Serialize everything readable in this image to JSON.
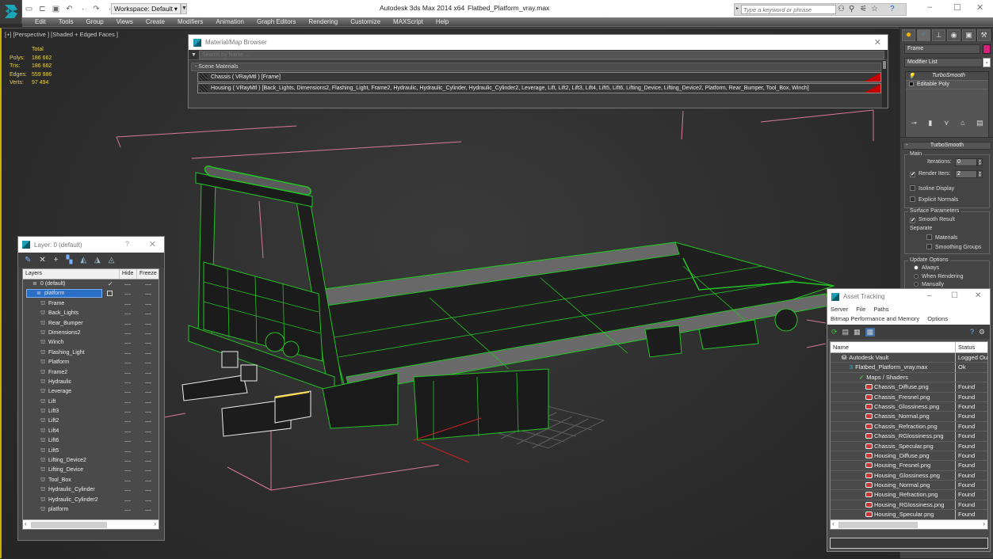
{
  "window": {
    "app_title": "Autodesk 3ds Max  2014 x64",
    "file_title": "Flatbed_Platform_vray.max",
    "workspace_label": "Workspace: Default",
    "help_search_placeholder": "Type a keyword or phrase",
    "quick_access": [
      "new-icon",
      "open-icon",
      "save-icon",
      "undo-icon",
      "redo-icon",
      "project-folder-icon"
    ],
    "help_icons": [
      "binoculars-icon",
      "key-icon",
      "satellite-icon",
      "star-icon",
      "help-icon"
    ]
  },
  "menu": [
    "Edit",
    "Tools",
    "Group",
    "Views",
    "Create",
    "Modifiers",
    "Animation",
    "Graph Editors",
    "Rendering",
    "Customize",
    "MAXScript",
    "Help"
  ],
  "viewport": {
    "label": "[+] [Perspective ] [Shaded + Edged Faces ]",
    "stats_header": "Total",
    "stats": [
      {
        "key": "Polys:",
        "value": "186 662"
      },
      {
        "key": "Tris:",
        "value": "186 662"
      },
      {
        "key": "Edges:",
        "value": "559 986"
      },
      {
        "key": "Verts:",
        "value": "97 494"
      }
    ],
    "selection_color": "#22c422",
    "highlight_color": "#c8b400"
  },
  "material_browser": {
    "title": "Material/Map Browser",
    "search_placeholder": "Search by Name ...",
    "section": "- Scene Materials",
    "items": [
      {
        "label": "Chassis  ( VRayMtl ) [Frame]"
      },
      {
        "label": "Housing  ( VRayMtl ) [Back_Lights, Dimensions2, Flashing_Light, Frame2, Hydraulic, Hydraulic_Cylinder, Hydraulic_Cylinder2, Leverage, Lift, Lift2, Lift3, Lift4, Lift5, Lift6, Lifting_Device, Lifting_Device2, Platform, Rear_Bumper, Tool_Box, Winch]"
      }
    ]
  },
  "command_panel": {
    "tabs": [
      "create-icon",
      "modify-icon",
      "hierarchy-icon",
      "motion-icon",
      "display-icon",
      "utilities-icon"
    ],
    "object_name": "Frame",
    "object_color": "#d8217a",
    "modifier_list": "Modifier List",
    "stack": [
      {
        "label": "TurboSmooth",
        "selected": true
      },
      {
        "label": "Editable Poly",
        "selected": false
      }
    ],
    "rollout_title": "TurboSmooth",
    "main_group": "Main",
    "iterations_label": "Iterations:",
    "iterations_value": "0",
    "render_iters_label": "Render Iters:",
    "render_iters_value": "2",
    "render_iters_checked": true,
    "isoline_label": "Isoline Display",
    "explicit_normals_label": "Explicit Normals",
    "surface_group": "Surface Parameters",
    "smooth_result_label": "Smooth Result",
    "separate_label": "Separate",
    "materials_label": "Materials",
    "smoothing_groups_label": "Smoothing Groups",
    "update_group": "Update Options",
    "update_options": [
      {
        "label": "Always",
        "selected": true
      },
      {
        "label": "When Rendering",
        "selected": false
      },
      {
        "label": "Manually",
        "selected": false
      }
    ]
  },
  "layer_dialog": {
    "title": "Layer: 0 (default)",
    "help": "?",
    "columns": [
      "Layers",
      "Hide",
      "Freeze"
    ],
    "toolbar": [
      "create-layer-icon",
      "delete-layer-icon",
      "add-to-layer-icon",
      "select-objects-icon",
      "highlight-icon",
      "hide-all-icon",
      "freeze-all-icon"
    ],
    "rows": [
      {
        "name": "0 (default)",
        "level": 0,
        "type": "layer",
        "active": true
      },
      {
        "name": "platform",
        "level": 0,
        "type": "layer",
        "selected": true
      },
      {
        "name": "Frame",
        "level": 1,
        "type": "object"
      },
      {
        "name": "Back_Lights",
        "level": 1,
        "type": "object"
      },
      {
        "name": "Rear_Bumper",
        "level": 1,
        "type": "object"
      },
      {
        "name": "Dimensions2",
        "level": 1,
        "type": "object"
      },
      {
        "name": "Winch",
        "level": 1,
        "type": "object"
      },
      {
        "name": "Flashing_Light",
        "level": 1,
        "type": "object"
      },
      {
        "name": "Platform",
        "level": 1,
        "type": "object"
      },
      {
        "name": "Frame2",
        "level": 1,
        "type": "object"
      },
      {
        "name": "Hydraulic",
        "level": 1,
        "type": "object"
      },
      {
        "name": "Leverage",
        "level": 1,
        "type": "object"
      },
      {
        "name": "Lift",
        "level": 1,
        "type": "object"
      },
      {
        "name": "Lift3",
        "level": 1,
        "type": "object"
      },
      {
        "name": "Lift2",
        "level": 1,
        "type": "object"
      },
      {
        "name": "Lift4",
        "level": 1,
        "type": "object"
      },
      {
        "name": "Lift6",
        "level": 1,
        "type": "object"
      },
      {
        "name": "Lift5",
        "level": 1,
        "type": "object"
      },
      {
        "name": "Lifting_Device2",
        "level": 1,
        "type": "object"
      },
      {
        "name": "Lifting_Device",
        "level": 1,
        "type": "object"
      },
      {
        "name": "Tool_Box",
        "level": 1,
        "type": "object"
      },
      {
        "name": "Hydraulic_Cylinder",
        "level": 1,
        "type": "object"
      },
      {
        "name": "Hydraulic_Cylinder2",
        "level": 1,
        "type": "object"
      },
      {
        "name": "platform",
        "level": 1,
        "type": "object"
      }
    ]
  },
  "asset_tracking": {
    "title": "Asset Tracking",
    "menu_row1": [
      "Server",
      "File",
      "Paths"
    ],
    "menu_row2": [
      "Bitmap Performance and Memory",
      "Options"
    ],
    "toolbar": [
      "refresh-icon",
      "list-icon",
      "details-icon",
      "table-icon",
      "help-vault-icon",
      "settings-vault-icon"
    ],
    "columns": [
      "Name",
      "Status"
    ],
    "rows": [
      {
        "name": "Autodesk Vault",
        "status": "Logged Ou",
        "level": 0,
        "icon": "vault-icon"
      },
      {
        "name": "Flatbed_Platform_vray.max",
        "status": "Ok",
        "level": 1,
        "icon": "max-file-icon"
      },
      {
        "name": "Maps / Shaders",
        "status": "",
        "level": 2,
        "icon": "maps-icon"
      },
      {
        "name": "Chassis_Diffuse.png",
        "status": "Found",
        "level": 3,
        "icon": "png-icon"
      },
      {
        "name": "Chassis_Fresnel.png",
        "status": "Found",
        "level": 3,
        "icon": "png-icon"
      },
      {
        "name": "Chassis_Glossiness.png",
        "status": "Found",
        "level": 3,
        "icon": "png-icon"
      },
      {
        "name": "Chassis_Normal.png",
        "status": "Found",
        "level": 3,
        "icon": "png-icon"
      },
      {
        "name": "Chassis_Refraction.png",
        "status": "Found",
        "level": 3,
        "icon": "png-icon"
      },
      {
        "name": "Chassis_RGlossiness.png",
        "status": "Found",
        "level": 3,
        "icon": "png-icon"
      },
      {
        "name": "Chassis_Specular.png",
        "status": "Found",
        "level": 3,
        "icon": "png-icon"
      },
      {
        "name": "Housing_Diffuse.png",
        "status": "Found",
        "level": 3,
        "icon": "png-icon"
      },
      {
        "name": "Housing_Fresnel.png",
        "status": "Found",
        "level": 3,
        "icon": "png-icon"
      },
      {
        "name": "Housing_Glossiness.png",
        "status": "Found",
        "level": 3,
        "icon": "png-icon"
      },
      {
        "name": "Housing_Normal.png",
        "status": "Found",
        "level": 3,
        "icon": "png-icon"
      },
      {
        "name": "Housing_Refraction.png",
        "status": "Found",
        "level": 3,
        "icon": "png-icon"
      },
      {
        "name": "Housing_RGlossiness.png",
        "status": "Found",
        "level": 3,
        "icon": "png-icon"
      },
      {
        "name": "Housing_Specular.png",
        "status": "Found",
        "level": 3,
        "icon": "png-icon"
      }
    ]
  }
}
